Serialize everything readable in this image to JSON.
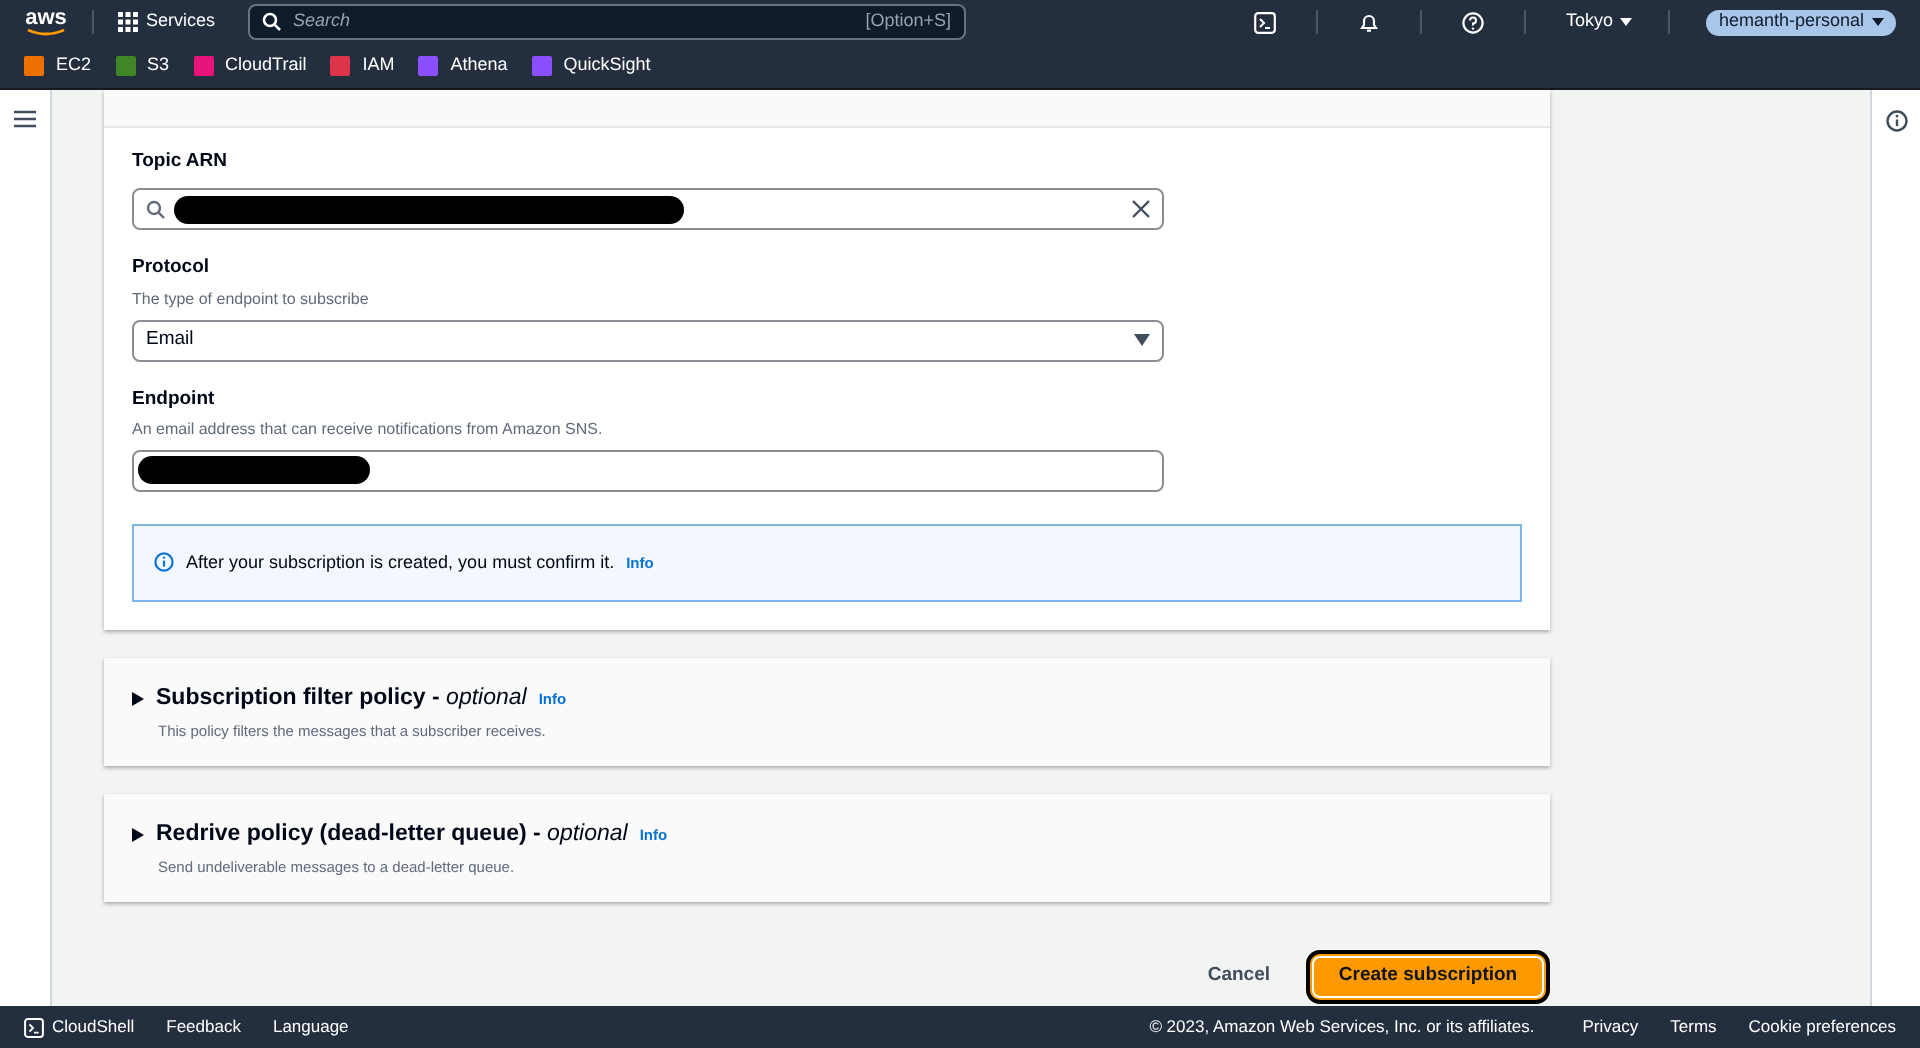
{
  "top_nav": {
    "logo": "aws",
    "services": "Services",
    "search": {
      "placeholder": "Search",
      "shortcut": "[Option+S]"
    },
    "region": "Tokyo",
    "account": "hemanth-personal"
  },
  "favorites": [
    {
      "label": "EC2",
      "color": "#ed7100"
    },
    {
      "label": "S3",
      "color": "#3f8624"
    },
    {
      "label": "CloudTrail",
      "color": "#e7157b"
    },
    {
      "label": "IAM",
      "color": "#dd344c"
    },
    {
      "label": "Athena",
      "color": "#8c4fff"
    },
    {
      "label": "QuickSight",
      "color": "#8c4fff"
    }
  ],
  "details": {
    "fields": [
      {
        "kind": "search",
        "label": "Topic ARN"
      },
      {
        "kind": "select",
        "label": "Protocol",
        "description": "The type of endpoint to subscribe",
        "value": "Email"
      },
      {
        "kind": "text",
        "label": "Endpoint",
        "description": "An email address that can receive notifications from Amazon SNS."
      }
    ],
    "alert": {
      "text": "After your subscription is created, you must confirm it.",
      "link": "Info"
    }
  },
  "sections": [
    {
      "title": "Subscription filter policy - ",
      "optional": "optional",
      "info": "Info",
      "description": "This policy filters the messages that a subscriber receives.",
      "expanded": false
    },
    {
      "title": "Redrive policy (dead-letter queue) - ",
      "optional": "optional",
      "info": "Info",
      "description": "Send undeliverable messages to a dead-letter queue.",
      "expanded": false
    }
  ],
  "actions": {
    "cancel": "Cancel",
    "create": "Create subscription"
  },
  "footer": {
    "cloudshell": "CloudShell",
    "feedback": "Feedback",
    "language": "Language",
    "copyright": "© 2023, Amazon Web Services, Inc. or its affiliates.",
    "links": [
      "Privacy",
      "Terms",
      "Cookie preferences"
    ]
  }
}
